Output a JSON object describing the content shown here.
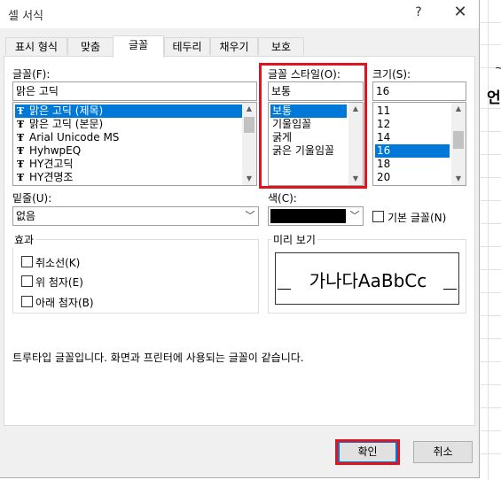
{
  "window": {
    "title": "셀 서식",
    "help": "?",
    "close": "✕"
  },
  "tabs": [
    "표시 형식",
    "맞춤",
    "글꼴",
    "테두리",
    "채우기",
    "보호"
  ],
  "font": {
    "label": "글꼴(F):",
    "value": "맑은 고딕",
    "items": [
      {
        "icon": "Ŧ",
        "name": "맑은 고딕 (제목)",
        "selected": true
      },
      {
        "icon": "Ŧ",
        "name": "맑은 고딕 (본문)",
        "selected": false
      },
      {
        "icon": "Ŧ",
        "name": "Arial Unicode MS",
        "selected": false
      },
      {
        "icon": "Ŧ",
        "name": "HyhwpEQ",
        "selected": false
      },
      {
        "icon": "Ŧ",
        "name": "HY견고딕",
        "selected": false
      },
      {
        "icon": "Ŧ",
        "name": "HY견명조",
        "selected": false
      }
    ]
  },
  "style": {
    "label": "글꼴 스타일(O):",
    "value": "보통",
    "items": [
      "보통",
      "기울임꼴",
      "굵게",
      "굵은 기울임꼴"
    ],
    "selected_index": 0
  },
  "size": {
    "label": "크기(S):",
    "value": "16",
    "items": [
      "11",
      "12",
      "14",
      "16",
      "18",
      "20"
    ],
    "selected_index": 3
  },
  "underline": {
    "label": "밑줄(U):",
    "value": "없음"
  },
  "color": {
    "label": "색(C):",
    "value": "#000000"
  },
  "normal_font": {
    "label": "기본 글꼴(N)",
    "checked": false
  },
  "effects": {
    "title": "효과",
    "items": [
      {
        "label": "취소선(K)",
        "checked": false
      },
      {
        "label": "위 첨자(E)",
        "checked": false
      },
      {
        "label": "아래 첨자(B)",
        "checked": false
      }
    ]
  },
  "preview": {
    "title": "미리 보기",
    "text": "가나다AaBbCc"
  },
  "info_text": "트루타입 글꼴입니다. 화면과 프린터에 사용되는 글꼴이 같습니다.",
  "buttons": {
    "ok": "확인",
    "cancel": "취소"
  },
  "background": {
    "text1": "언",
    "text2": "~"
  },
  "colors": {
    "accent": "#0078d7",
    "highlight": "#e0141e"
  }
}
